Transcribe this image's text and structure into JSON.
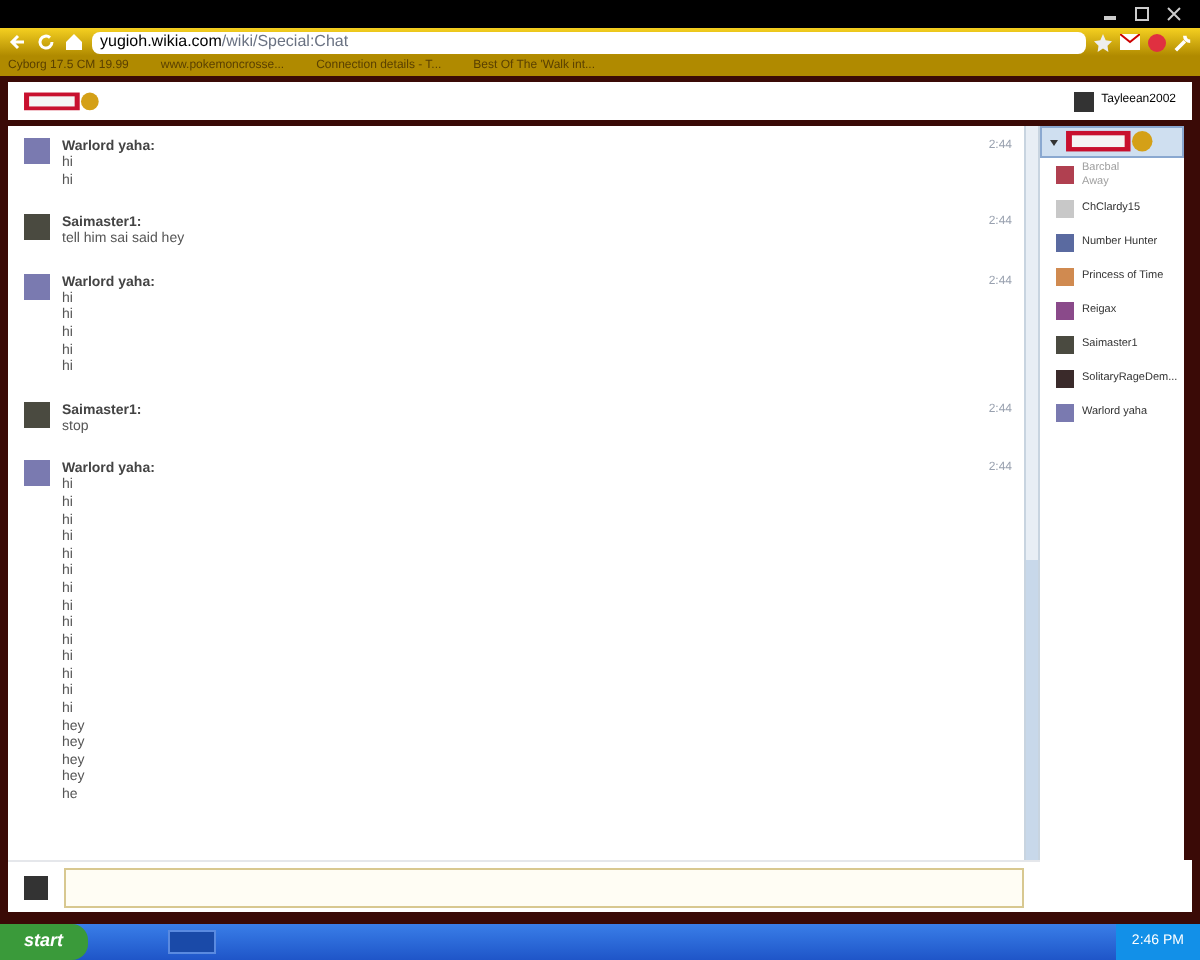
{
  "browser": {
    "url_host": "yugioh.wikia.com",
    "url_path": "/wiki/Special:Chat",
    "bookmarks": [
      {
        "label": "Cyborg 17.5 CM 19.99"
      },
      {
        "label": "www.pokemoncrosse..."
      },
      {
        "label": "Connection details - T..."
      },
      {
        "label": "Best Of The 'Walk int..."
      }
    ]
  },
  "header": {
    "user": "Tayleean2002"
  },
  "messages": [
    {
      "author": "Warlord yaha:",
      "time": "2:44",
      "color": "#7a7ab0",
      "lines": [
        "hi",
        "hi"
      ]
    },
    {
      "author": "Saimaster1:",
      "time": "2:44",
      "color": "#4a4a40",
      "lines": [
        "tell him sai said hey"
      ]
    },
    {
      "author": "Warlord yaha:",
      "time": "2:44",
      "color": "#7a7ab0",
      "lines": [
        "hi",
        "hi",
        "hi",
        "hi",
        "hi"
      ]
    },
    {
      "author": "Saimaster1:",
      "time": "2:44",
      "color": "#4a4a40",
      "lines": [
        "stop"
      ]
    },
    {
      "author": "Warlord yaha:",
      "time": "2:44",
      "color": "#7a7ab0",
      "lines": [
        "hi",
        "hi",
        "hi",
        "hi",
        "hi",
        "hi",
        "hi",
        "hi",
        "hi",
        "hi",
        "hi",
        "hi",
        "hi",
        "hi",
        "hey",
        "hey",
        "hey",
        "hey",
        "he"
      ]
    }
  ],
  "users": [
    {
      "name": "Barcbal",
      "status": "Away",
      "away": true,
      "color": "#b04050"
    },
    {
      "name": "ChClardy15",
      "away": false,
      "color": "#c8c8c8"
    },
    {
      "name": "Number Hunter",
      "away": false,
      "color": "#5a6aa0"
    },
    {
      "name": "Princess of Time",
      "away": false,
      "color": "#d08a50"
    },
    {
      "name": "Reigax",
      "away": false,
      "color": "#8a4a8a"
    },
    {
      "name": "Saimaster1",
      "away": false,
      "color": "#4a4a40"
    },
    {
      "name": "SolitaryRageDem...",
      "away": false,
      "color": "#3a2a2a"
    },
    {
      "name": "Warlord yaha",
      "away": false,
      "color": "#7a7ab0"
    }
  ],
  "taskbar": {
    "start": "start",
    "clock": "2:46 PM"
  }
}
